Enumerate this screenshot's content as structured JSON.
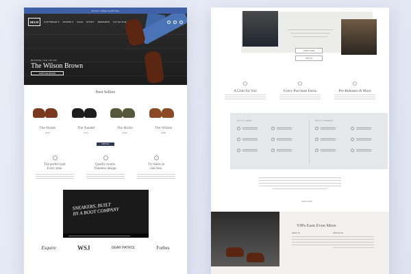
{
  "left": {
    "promo": "ENJOY FREE SHIPPING",
    "brand": "HELM",
    "nav": [
      "FOOTWEAR ▾",
      "GOODS ▾",
      "SALE",
      "STORY",
      "REWARDS",
      "STYLE FILE"
    ],
    "hero": {
      "eyebrow": "BROWSE THE COLOR",
      "title": "The Wilson Brown",
      "button": "SHOP THE WILSON"
    },
    "best_sellers": {
      "title": "Best Sellers",
      "view_all": "SHOP ALL",
      "products": [
        {
          "name": "The Hynes",
          "price": "$495",
          "color": "#7a3a20"
        },
        {
          "name": "The Xander",
          "price": "$175",
          "color": "#1d1d1d"
        },
        {
          "name": "The Hollis",
          "price": "$495",
          "color": "#55583b"
        },
        {
          "name": "The Wilson",
          "price": "$395",
          "color": "#8a4a26"
        }
      ]
    },
    "features": [
      {
        "title_line1": "The perfect pair",
        "title_line2": "Every time."
      },
      {
        "title_line1": "Quality rooms.",
        "title_line2": "Timeless design."
      },
      {
        "title_line1": "Try them on",
        "title_line2": "risk-free."
      }
    ],
    "video": {
      "caption_line1": "SNEAKERS, BUILT",
      "caption_line2": "BY A BOOT COMPANY"
    },
    "press": [
      "Esquire",
      "WSJ",
      "GEAR PATROL",
      "Forbes"
    ]
  },
  "right": {
    "buttons": [
      "LEARN MORE",
      "SIGN UP"
    ],
    "columns": [
      {
        "title": "A Club for You"
      },
      {
        "title": "Every Purchase Earns"
      },
      {
        "title": "Pre-Releases & More"
      }
    ],
    "tiers": {
      "left_head": "WAYS TO EARN",
      "right_head": "WAYS TO REDEEM"
    },
    "learn_more": "LEARN MORE",
    "vip_title": "VIPs Earn Even More",
    "vip_cols": [
      "HELM VIP",
      "HELM ELITE"
    ]
  }
}
